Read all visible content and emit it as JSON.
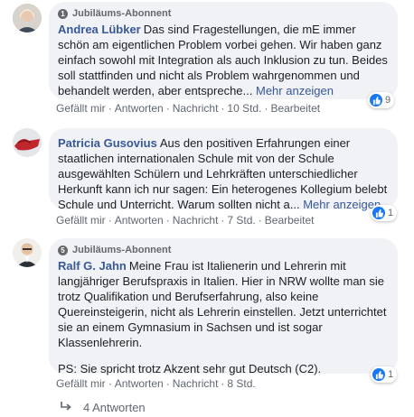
{
  "comments": [
    {
      "badge": "Jubiläums-Abonnent",
      "author": "Andrea Lübker",
      "text": "Das sind Fragestellungen, die mE immer schön am eigentlichen Problem vorbei gehen. Wir haben ganz einfach sowohl mit Integration als auch Inklusion zu tun. Beides soll stattfinden und nicht als Problem wahrgenommen und behandelt werden, aber entspreche...",
      "more": "Mehr anzeigen",
      "like": "Gefällt mir",
      "reply": "Antworten",
      "message": "Nachricht",
      "time": "10 Std.",
      "edited": "Bearbeitet",
      "reactions": "9"
    },
    {
      "author": "Patricia Gusovius",
      "text": "Aus den positiven Erfahrungen einer staatlichen internationalen Schule mit von der Schule ausgewählten Schülern und Lehrkräften unterschiedlicher Herkunft kann ich nur sagen: Ein heterogenes Kollegium belebt Schule und Unterricht. Warum sollten nicht a...",
      "more": "Mehr anzeigen",
      "like": "Gefällt mir",
      "reply": "Antworten",
      "message": "Nachricht",
      "time": "7 Std.",
      "edited": "Bearbeitet",
      "reactions": "1"
    },
    {
      "badge": "Jubiläums-Abonnent",
      "author": "Ralf G. Jahn",
      "text": "Meine Frau ist Italienerin und Lehrerin mit langjähriger Berufspraxis in Italien. Hier in NRW wollte man sie trotz Qualifikation und Berufserfahrung, also keine Quereinsteigerin, nicht als Lehrerin einstellen. Jetzt unterrichtet sie an einem Gymnasium in Sachsen und ist sogar Klassenlehrerin.",
      "ps": "PS: Sie spricht trotz Akzent sehr gut Deutsch (C2).",
      "like": "Gefällt mir",
      "reply": "Antworten",
      "message": "Nachricht",
      "time": "8 Std.",
      "reactions": "1"
    }
  ],
  "replies_label": "4 Antworten",
  "colors": {
    "link": "#385898",
    "bubble": "#f0f2f5",
    "like": "#1877f2"
  }
}
